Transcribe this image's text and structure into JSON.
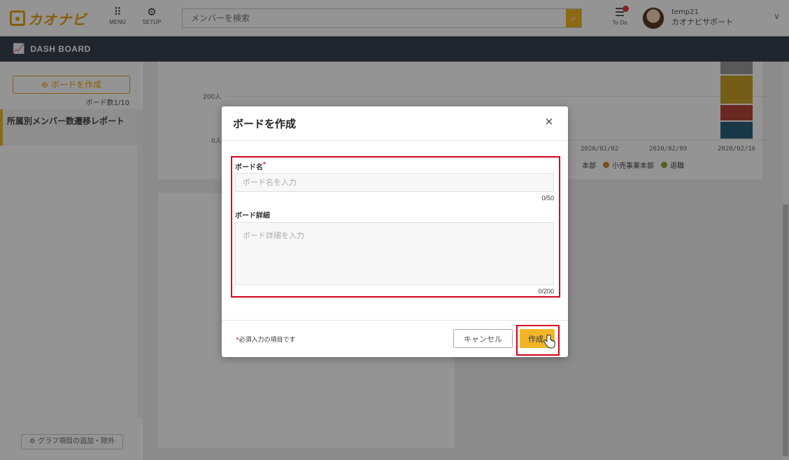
{
  "header": {
    "logo_text": "カオナビ",
    "menu_label": "MENU",
    "setup_label": "SETUP",
    "search_placeholder": "メンバーを検索",
    "todo_label": "To Do",
    "user_id": "temp21",
    "user_org": "カオナビサポート"
  },
  "dashbar": {
    "title": "DASH BOARD"
  },
  "sidebar": {
    "create_label": "ボードを作成",
    "board_count": "ボード数1/10",
    "items": [
      {
        "label": "所属別メンバー数遷移レポート"
      }
    ],
    "graph_edit_label": "グラフ項目の追加・除外"
  },
  "chart": {
    "y_ticks": [
      "200人",
      "0人"
    ],
    "x_dates": [
      "2020/02/02",
      "2020/02/09",
      "2020/02/16"
    ],
    "legend": [
      {
        "name": "本部",
        "color": "#2a5f7a"
      },
      {
        "name": "小売事業本部",
        "color": "#d08a2a"
      },
      {
        "name": "退職",
        "color": "#8aa83a"
      }
    ],
    "bar_colors": [
      "#9a9a9a",
      "#c9a227",
      "#b8443a",
      "#2a5f7a"
    ]
  },
  "modal": {
    "title": "ボードを作成",
    "name_label": "ボード名",
    "required_mark": "*",
    "name_placeholder": "ボード名を入力",
    "name_counter": "0/50",
    "detail_label": "ボード詳細",
    "detail_placeholder": "ボード詳細を入力",
    "detail_counter": "0/200",
    "footnote": "必須入力の項目です",
    "cancel_label": "キャンセル",
    "create_label": "作成"
  }
}
